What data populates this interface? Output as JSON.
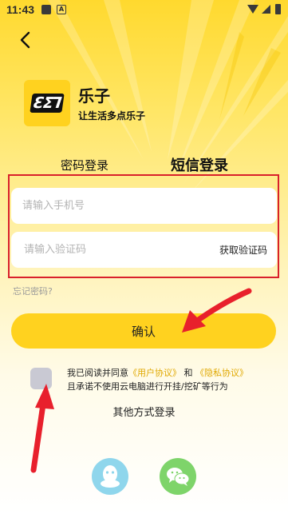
{
  "status_bar": {
    "time": "11:43",
    "notif_label": "A",
    "icons": [
      "notification-icon",
      "a-icon",
      "wifi-icon",
      "signal-icon",
      "battery-icon"
    ]
  },
  "nav": {
    "back_icon": "chevron-left-icon"
  },
  "brand": {
    "logo_text": "ƐΣ⅂",
    "app_name": "乐子",
    "slogan": "让生活多点乐子"
  },
  "tabs": [
    {
      "label": "密码登录",
      "active": false
    },
    {
      "label": "短信登录",
      "active": true
    }
  ],
  "form": {
    "phone_placeholder": "请输入手机号",
    "phone_value": "",
    "code_placeholder": "请输入验证码",
    "code_value": "",
    "get_code_label": "获取验证码"
  },
  "forgot_password": "忘记密码?",
  "confirm_label": "确认",
  "agreement": {
    "checked": false,
    "prefix": "我已阅读并同意",
    "user_agreement": "《用户协议》",
    "and": "和",
    "privacy_policy": "《隐私协议》",
    "suffix": "且承诺不使用云电脑进行开挂/挖矿等行为"
  },
  "other_login_label": "其他方式登录",
  "social": [
    "qq-icon",
    "wechat-icon"
  ],
  "colors": {
    "accent": "#ffd21f",
    "annotation_red": "#d9202b",
    "link": "#e0a800"
  }
}
